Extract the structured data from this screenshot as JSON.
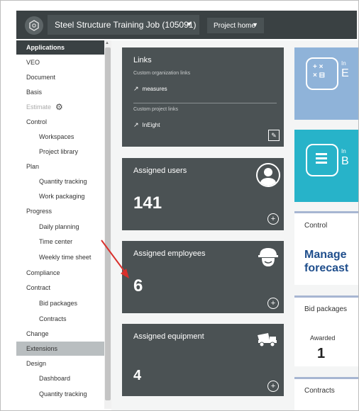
{
  "header": {
    "project_name": "Steel Structure Training Job (105091)",
    "project_home": "Project home",
    "caret": "▼"
  },
  "sidebar": {
    "items": [
      {
        "label": "Applications"
      },
      {
        "label": "VEO"
      },
      {
        "label": "Document"
      },
      {
        "label": "Basis"
      },
      {
        "label": "Estimate"
      },
      {
        "label": "Control"
      },
      {
        "label": "Workspaces"
      },
      {
        "label": "Project library"
      },
      {
        "label": "Plan"
      },
      {
        "label": "Quantity tracking"
      },
      {
        "label": "Work packaging"
      },
      {
        "label": "Progress"
      },
      {
        "label": "Daily planning"
      },
      {
        "label": "Time center"
      },
      {
        "label": "Weekly time sheet"
      },
      {
        "label": "Compliance"
      },
      {
        "label": "Contract"
      },
      {
        "label": "Bid packages"
      },
      {
        "label": "Contracts"
      },
      {
        "label": "Change"
      },
      {
        "label": "Extensions"
      },
      {
        "label": "Design"
      },
      {
        "label": "Dashboard"
      },
      {
        "label": "Quantity tracking"
      }
    ]
  },
  "links_card": {
    "title": "Links",
    "org_heading": "Custom organization links",
    "org_link": "measures",
    "proj_heading": "Custom project links",
    "proj_link": "InEight"
  },
  "users_card": {
    "title": "Assigned users",
    "count": "141"
  },
  "employees_card": {
    "title": "Assigned employees",
    "count": "6"
  },
  "equipment_card": {
    "title": "Assigned equipment",
    "count": "4"
  },
  "right_tiles": {
    "estimate_tile": {
      "small": "In",
      "big": "E"
    },
    "basis_tile": {
      "small": "In",
      "big": "B"
    }
  },
  "control_card": {
    "title": "Control",
    "line1": "Manage",
    "line2": "forecast"
  },
  "bid_card": {
    "title": "Bid packages",
    "awarded_label": "Awarded",
    "awarded_count": "1"
  },
  "contracts_card": {
    "title": "Contracts"
  },
  "colors": {
    "dark": "#3a4143",
    "card": "#4b5254",
    "light_blue_tile": "#8fb3d9",
    "cyan_tile": "#27b3c9",
    "accent_navy": "#1f4e8c",
    "arrow_red": "#d9302c"
  }
}
